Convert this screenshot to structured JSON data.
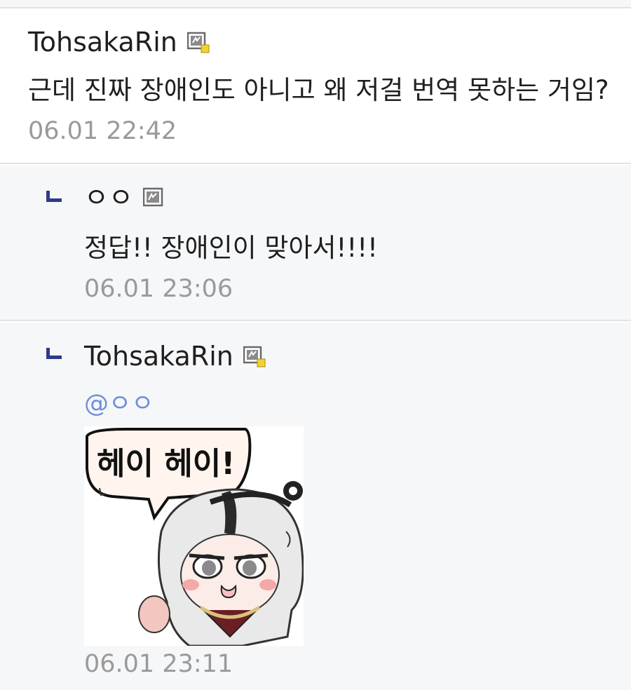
{
  "comments": [
    {
      "author": "TohsakaRin",
      "text": "근데 진짜 장애인도 아니고 왜 저걸 번역 못하는 거임?",
      "time": "06.01 22:42",
      "badge": "fixed-nick-gallog-icon-yellow"
    },
    {
      "author": "ㅇㅇ",
      "text": "정답!! 장애인이 맞아서!!!!",
      "time": "06.01 23:06",
      "badge": "gallog-icon"
    },
    {
      "author": "TohsakaRin",
      "mention": "@ㅇㅇ",
      "time": "06.01 23:11",
      "badge": "fixed-nick-gallog-icon-yellow",
      "sticker": {
        "text": "헤이 헤이!",
        "icon": "anime-girl-sticker"
      }
    }
  ],
  "colors": {
    "reply_mark": "#2d3a88",
    "mention": "#6f8fd9",
    "time": "#9a9a9a",
    "divider": "#e2e3e6",
    "reply_bg": "#f6f7f9"
  }
}
